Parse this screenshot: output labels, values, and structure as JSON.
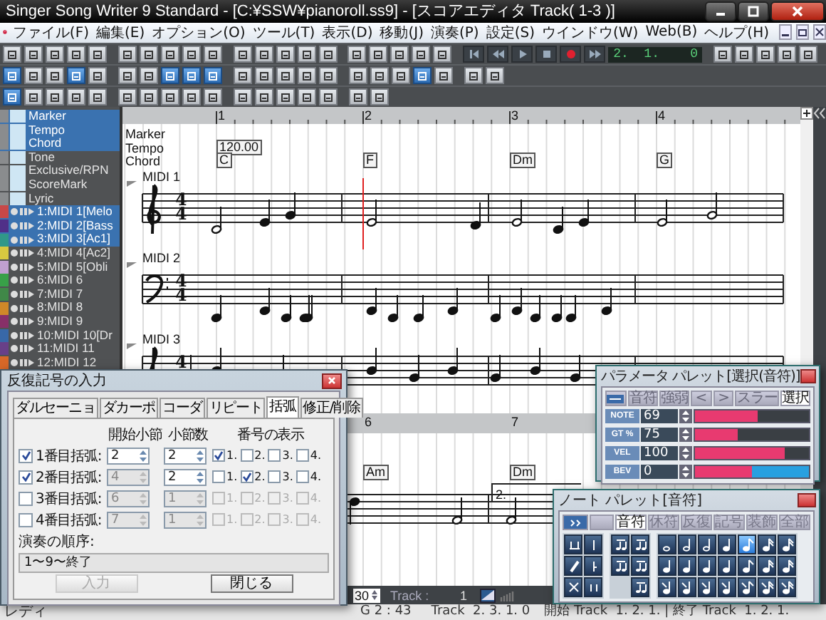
{
  "window": {
    "title": "Singer Song Writer 9 Standard - [C:¥SSW¥pianoroll.ss9] - [スコアエディタ Track( 1-3 )]"
  },
  "menu": [
    "ファイル(F)",
    "編集(E)",
    "オプション(O)",
    "ツール(T)",
    "表示(D)",
    "移動(J)",
    "演奏(P)",
    "設定(S)",
    "ウインドウ(W)",
    "Web(B)",
    "ヘルプ(H)"
  ],
  "toolbar_1": {
    "tools_left": [
      {
        "on": false
      },
      {
        "on": false
      },
      {
        "on": false
      },
      {
        "on": false
      },
      {
        "on": false
      },
      {
        "on": false
      },
      {
        "on": false
      },
      {
        "on": false
      },
      {
        "on": false
      },
      {
        "on": false
      },
      {
        "on": false
      },
      {
        "on": false
      },
      {
        "on": false
      },
      {
        "on": false
      },
      {
        "on": false
      },
      {
        "on": false
      },
      {
        "on": false
      },
      {
        "on": false
      },
      {
        "on": false
      },
      {
        "on": false
      }
    ],
    "transport": [
      {
        "kind": "skip-to-start"
      },
      {
        "kind": "rewind"
      },
      {
        "kind": "play"
      },
      {
        "kind": "stop"
      },
      {
        "kind": "record"
      },
      {
        "kind": "fast-forward"
      }
    ],
    "counter": "2.  1.    0",
    "tools_right": [
      {
        "on": false
      },
      {
        "on": false
      },
      {
        "on": false
      },
      {
        "on": false
      },
      {
        "on": false
      }
    ]
  },
  "toolbar_2": [
    {
      "on": true
    },
    {
      "on": false
    },
    {
      "on": false
    },
    {
      "on": true
    },
    {
      "on": false
    },
    {
      "on": false
    },
    {
      "on": false
    },
    {
      "on": true
    },
    {
      "on": true
    },
    {
      "on": true
    },
    {
      "on": false
    },
    {
      "on": false
    },
    {
      "on": false
    },
    {
      "on": false
    },
    {
      "on": false
    },
    {
      "on": false
    },
    {
      "on": false
    },
    {
      "on": false
    },
    {
      "on": true
    },
    {
      "on": false
    },
    {
      "on": false
    },
    {
      "on": false
    }
  ],
  "toolbar_3": [
    {
      "on": true
    },
    {
      "on": false
    },
    {
      "on": false
    },
    {
      "on": false
    },
    {
      "on": false
    },
    {
      "on": false
    },
    {
      "on": false
    },
    {
      "on": false
    },
    {
      "on": false
    },
    {
      "on": false
    },
    {
      "on": false
    },
    {
      "on": false
    },
    {
      "on": false
    },
    {
      "on": false
    },
    {
      "on": false
    },
    {
      "on": false
    },
    {
      "on": false
    }
  ],
  "track_list": {
    "system_tracks": [
      {
        "name": "Marker",
        "selected": true
      },
      {
        "name": "Tempo",
        "selected": true
      },
      {
        "name": "Chord",
        "selected": true
      },
      {
        "name": "Tone",
        "selected": false
      },
      {
        "name": "Exclusive/RPN",
        "selected": false
      },
      {
        "name": "ScoreMark",
        "selected": false
      },
      {
        "name": "Lyric",
        "selected": false
      }
    ],
    "midi_tracks": [
      {
        "name": "1:MIDI 1[Melo",
        "color": "#c84848",
        "selected": true
      },
      {
        "name": "2:MIDI 2[Bass",
        "color": "#503088",
        "selected": true
      },
      {
        "name": "3:MIDI 3[Ac1]",
        "color": "#309888",
        "selected": true
      },
      {
        "name": "4:MIDI 4[Ac2]",
        "color": "#d8c840",
        "selected": false
      },
      {
        "name": "5:MIDI 5[Obli",
        "color": "#c0a0d0",
        "selected": false
      },
      {
        "name": "6:MIDI 6",
        "color": "#38a048",
        "selected": false
      },
      {
        "name": "7:MIDI 7",
        "color": "#408848",
        "selected": false
      },
      {
        "name": "8:MIDI 8",
        "color": "#d08828",
        "selected": false
      },
      {
        "name": "9:MIDI 9",
        "color": "#883068",
        "selected": false
      },
      {
        "name": "10:MIDI 10[Dr",
        "color": "#3868a8",
        "selected": false
      },
      {
        "name": "11:MIDI 11",
        "color": "#684088",
        "selected": false
      },
      {
        "name": "12:MIDI 12",
        "color": "#d86828",
        "selected": false
      }
    ]
  },
  "score": {
    "measure_numbers": [
      "1",
      "2",
      "3",
      "4"
    ],
    "row_labels": [
      "Marker",
      "Tempo",
      "Chord"
    ],
    "tempo": "120.00",
    "chords": [
      "C",
      "F",
      "Dm",
      "G"
    ],
    "staves": [
      {
        "label": "MIDI 1",
        "kind": "treble",
        "beats": "4",
        "unit": "4"
      },
      {
        "label": "MIDI 2",
        "kind": "bass",
        "beats": "4",
        "unit": "4"
      },
      {
        "label": "MIDI 3",
        "kind": "treble",
        "beats": "4"
      }
    ],
    "lower_measure_numbers": [
      "6",
      "7"
    ],
    "lower_chords": [
      "Am",
      "Dm"
    ],
    "volta": "2.",
    "zoom": "30",
    "track_label": "Track :",
    "track_value": "1"
  },
  "repeat_dialog": {
    "title": "反復記号の入力",
    "tabs": [
      {
        "label": "ダルセーニョ",
        "selected": false
      },
      {
        "label": "ダカーポ",
        "selected": false
      },
      {
        "label": "コーダ",
        "selected": false
      },
      {
        "label": "リピート",
        "selected": false
      },
      {
        "label": "括弧",
        "selected": true
      },
      {
        "label": "修正/削除",
        "selected": false
      }
    ],
    "column_headers": [
      "開始小節",
      "小節数",
      "番号の表示"
    ],
    "brackets": [
      {
        "label": "1番目括弧:",
        "checked": true,
        "start": "2",
        "start_disabled": false,
        "count": "2",
        "numbers": [
          {
            "label": "1.",
            "checked": true
          },
          {
            "label": "2.",
            "checked": false
          },
          {
            "label": "3.",
            "checked": false
          },
          {
            "label": "4.",
            "checked": false
          }
        ]
      },
      {
        "label": "2番目括弧:",
        "checked": true,
        "start": "4",
        "start_disabled": true,
        "count": "2",
        "numbers": [
          {
            "label": "1.",
            "checked": false
          },
          {
            "label": "2.",
            "checked": true
          },
          {
            "label": "3.",
            "checked": false
          },
          {
            "label": "4.",
            "checked": false
          }
        ]
      },
      {
        "label": "3番目括弧:",
        "checked": false,
        "start": "6",
        "start_disabled": true,
        "count": "1",
        "numbers": [
          {
            "label": "1.",
            "checked": false
          },
          {
            "label": "2.",
            "checked": false
          },
          {
            "label": "3.",
            "checked": false
          },
          {
            "label": "4.",
            "checked": false
          }
        ]
      },
      {
        "label": "4番目括弧:",
        "checked": false,
        "start": "7",
        "start_disabled": true,
        "count": "1",
        "numbers": [
          {
            "label": "1.",
            "checked": false
          },
          {
            "label": "2.",
            "checked": false
          },
          {
            "label": "3.",
            "checked": false
          },
          {
            "label": "4.",
            "checked": false
          }
        ]
      }
    ],
    "order_label": "演奏の順序:",
    "order_value": "1〜9〜終了",
    "buttons": [
      {
        "label": "入力",
        "disabled": true
      },
      {
        "label": "閉じる",
        "disabled": false
      }
    ]
  },
  "parameter_palette": {
    "title": "パラメータ パレット[選択(音符)]",
    "tabs": [
      {
        "kind": "icon",
        "selected": false
      },
      {
        "kind": "text",
        "label": "音符",
        "selected": false
      },
      {
        "kind": "text",
        "label": "強弱",
        "selected": false
      },
      {
        "kind": "text",
        "label": "<",
        "selected": false
      },
      {
        "kind": "text",
        "label": ">",
        "selected": false
      },
      {
        "kind": "text",
        "label": "スラー",
        "selected": false
      },
      {
        "kind": "text",
        "label": "選択",
        "selected": true
      }
    ],
    "rows": [
      {
        "label": "NOTE",
        "value": "69",
        "kind": "bar",
        "level": 0.55
      },
      {
        "label": "GT %",
        "value": "75",
        "kind": "bar",
        "level": 0.37
      },
      {
        "label": "VEL",
        "value": "100",
        "kind": "bar",
        "level": 0.79
      },
      {
        "label": "BEV",
        "value": "0",
        "kind": "bipolar",
        "level": 0.5
      }
    ]
  },
  "note_palette": {
    "title": "ノート パレット[音符]",
    "tabs": [
      {
        "kind": "icon",
        "selected": false
      },
      {
        "kind": "blank",
        "selected": false
      },
      {
        "kind": "text",
        "label": "音符",
        "selected": true
      },
      {
        "kind": "text",
        "label": "休符",
        "selected": false
      },
      {
        "kind": "text",
        "label": "反復",
        "selected": false
      },
      {
        "kind": "text",
        "label": "記号",
        "selected": false
      },
      {
        "kind": "text",
        "label": "装飾",
        "selected": false
      },
      {
        "kind": "text",
        "label": "全部",
        "selected": false
      }
    ],
    "note_buttons": [
      {
        "selected": false
      },
      {
        "selected": false
      },
      {
        "selected": false
      },
      {
        "selected": false
      },
      {
        "selected": true
      },
      {
        "selected": false
      },
      {
        "selected": false
      },
      {
        "selected": false
      },
      {
        "selected": false
      },
      {
        "selected": false
      },
      {
        "selected": false
      },
      {
        "selected": false
      },
      {
        "selected": false
      },
      {
        "selected": false
      },
      {
        "selected": false
      },
      {
        "selected": false
      },
      {
        "selected": false
      },
      {
        "selected": false
      },
      {
        "selected": false
      },
      {
        "selected": false
      },
      {
        "selected": false
      }
    ]
  },
  "status_bar": {
    "state": "レディ",
    "position": "G 2 : 43",
    "track": "Track  2. 3. 1. 0",
    "range": "開始 Track  1. 2. 1. | 終了 Track  1. 2. 1."
  }
}
